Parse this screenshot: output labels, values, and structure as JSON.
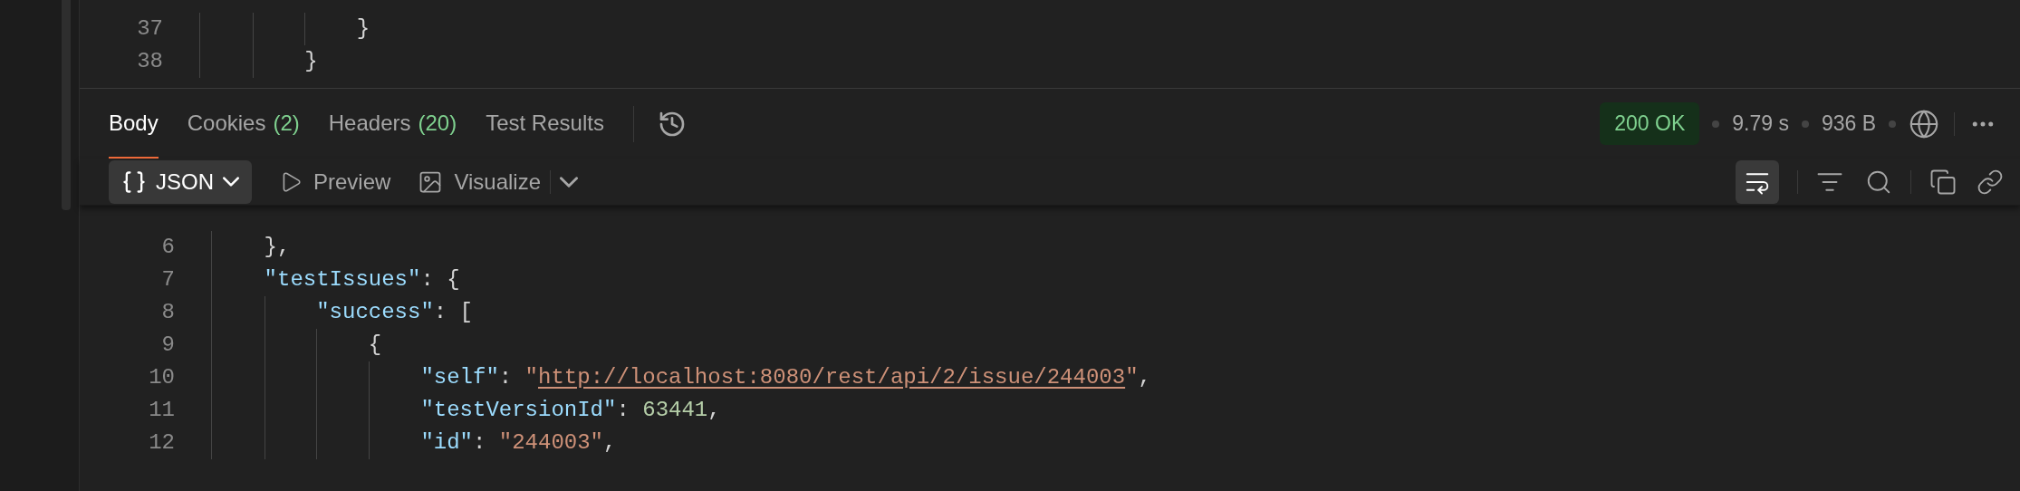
{
  "request_editor": {
    "lines": [
      {
        "number": "37",
        "tokens": [
          {
            "kind": "punct",
            "text": "            }"
          }
        ]
      },
      {
        "number": "38",
        "tokens": [
          {
            "kind": "punct",
            "text": "        }"
          }
        ]
      }
    ]
  },
  "response": {
    "tabs": [
      {
        "label": "Body",
        "selected": true
      },
      {
        "label": "Cookies",
        "count": "(2)",
        "selected": false
      },
      {
        "label": "Headers",
        "count": "(20)",
        "selected": false
      },
      {
        "label": "Test Results",
        "selected": false
      }
    ],
    "status": {
      "code": "200 OK",
      "time": "9.79 s",
      "size": "936 B"
    },
    "format": "JSON",
    "view_buttons": [
      {
        "kind": "preview",
        "label": "Preview"
      },
      {
        "kind": "visualize",
        "label": "Visualize"
      }
    ],
    "wrap_lines": {
      "selected": true
    },
    "lines": [
      {
        "number": "6",
        "tokens": [
          {
            "kind": "punct",
            "text": "    },"
          }
        ]
      },
      {
        "number": "7",
        "tokens": [
          {
            "kind": "key",
            "text": "    \"testIssues\""
          },
          {
            "kind": "punct",
            "text": ": {"
          }
        ]
      },
      {
        "number": "8",
        "tokens": [
          {
            "kind": "key",
            "text": "        \"success\""
          },
          {
            "kind": "punct",
            "text": ": ["
          }
        ]
      },
      {
        "number": "9",
        "tokens": [
          {
            "kind": "punct",
            "text": "            {"
          }
        ]
      },
      {
        "number": "10",
        "tokens": [
          {
            "kind": "key",
            "text": "                \"self\""
          },
          {
            "kind": "punct",
            "text": ": "
          },
          {
            "kind": "string",
            "text": "\""
          },
          {
            "kind": "link",
            "text": "http://localhost:8080/rest/api/2/issue/244003"
          },
          {
            "kind": "string",
            "text": "\""
          },
          {
            "kind": "punct",
            "text": ","
          }
        ]
      },
      {
        "number": "11",
        "tokens": [
          {
            "kind": "key",
            "text": "                \"testVersionId\""
          },
          {
            "kind": "punct",
            "text": ": "
          },
          {
            "kind": "number",
            "text": "63441"
          },
          {
            "kind": "punct",
            "text": ","
          }
        ]
      },
      {
        "number": "12",
        "tokens": [
          {
            "kind": "key",
            "text": "                \"id\""
          },
          {
            "kind": "punct",
            "text": ": "
          },
          {
            "kind": "string",
            "text": "\"244003\""
          },
          {
            "kind": "punct",
            "text": ","
          }
        ]
      }
    ]
  }
}
